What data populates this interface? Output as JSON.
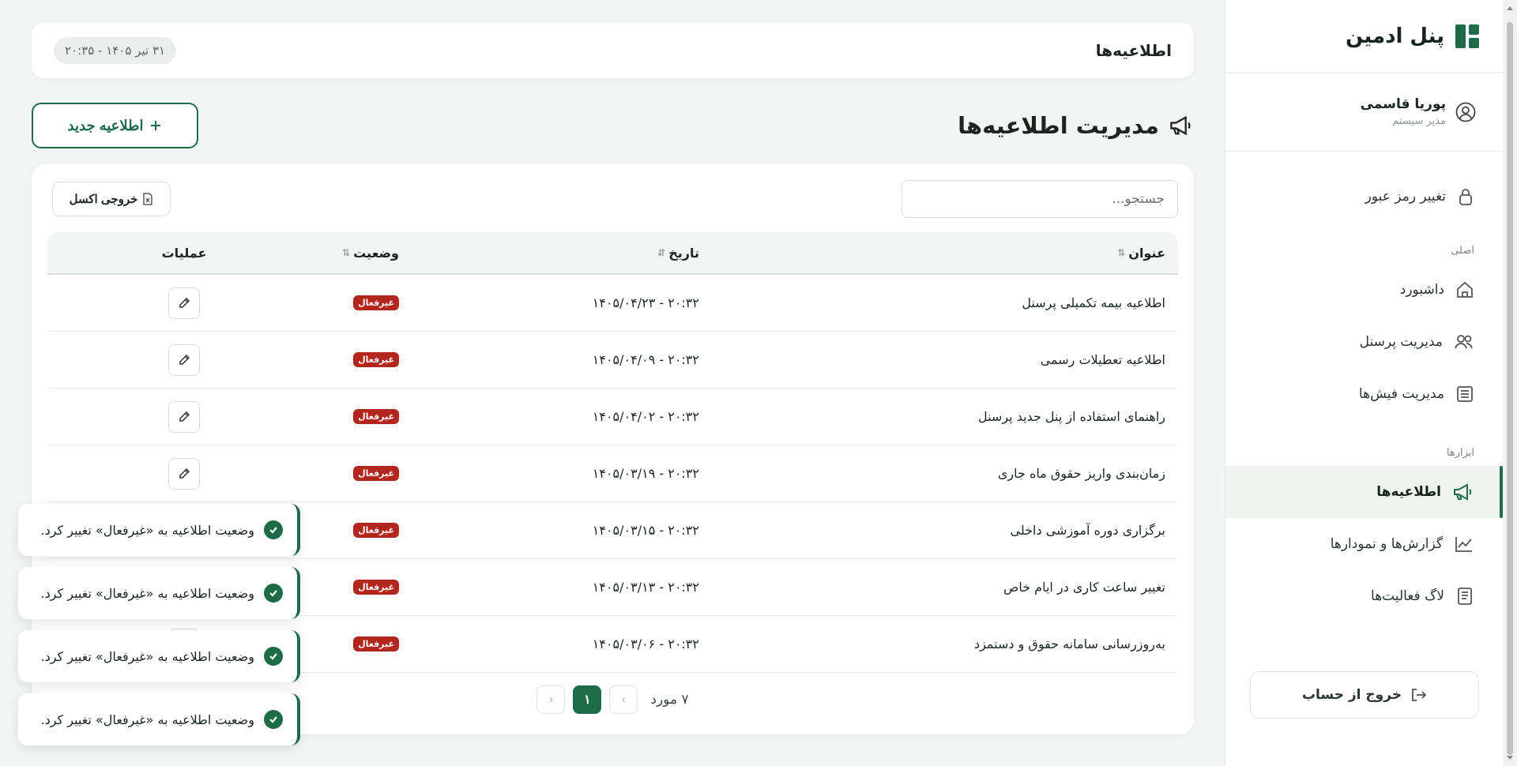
{
  "sidebar": {
    "brand": "پنل ادمین",
    "user": {
      "name": "پوریا قاسمی",
      "role": "مدیر سیستم"
    },
    "change_password": "تغییر رمز عبور",
    "section_main": "اصلی",
    "main_items": [
      {
        "label": "داشبورد",
        "icon": "home-icon"
      },
      {
        "label": "مدیریت پرسنل",
        "icon": "users-icon"
      },
      {
        "label": "مدیریت فیش‌ها",
        "icon": "receipt-icon"
      }
    ],
    "section_tools": "ابزارها",
    "tools_items": [
      {
        "label": "اطلاعیه‌ها",
        "icon": "megaphone-icon",
        "active": true
      },
      {
        "label": "گزارش‌ها و نمودارها",
        "icon": "chart-icon"
      },
      {
        "label": "لاگ فعالیت‌ها",
        "icon": "log-icon"
      }
    ],
    "logout": "خروج از حساب"
  },
  "topbar": {
    "title": "اطلاعیه‌ها",
    "datetime": "۳۱ تیر ۱۴۰۵ - ۲۰:۳۵"
  },
  "page": {
    "title": "مدیریت اطلاعیه‌ها",
    "new_button": "اطلاعیه جدید"
  },
  "toolbar": {
    "search_placeholder": "جستجو...",
    "excel_label": "خروجی اکسل"
  },
  "table": {
    "headers": {
      "title": "عنوان",
      "date": "تاریخ",
      "status": "وضعیت",
      "actions": "عملیات"
    },
    "rows": [
      {
        "title": "اطلاعیه بیمه تکمیلی پرسنل",
        "date": "۱۴۰۵/۰۴/۲۳ - ۲۰:۳۲",
        "status": "غیرفعال"
      },
      {
        "title": "اطلاعیه تعطیلات رسمی",
        "date": "۱۴۰۵/۰۴/۰۹ - ۲۰:۳۲",
        "status": "غیرفعال"
      },
      {
        "title": "راهنمای استفاده از پنل جدید پرسنل",
        "date": "۱۴۰۵/۰۴/۰۲ - ۲۰:۳۲",
        "status": "غیرفعال"
      },
      {
        "title": "زمان‌بندی واریز حقوق ماه جاری",
        "date": "۱۴۰۵/۰۳/۱۹ - ۲۰:۳۲",
        "status": "غیرفعال"
      },
      {
        "title": "برگزاری دوره آموزشی داخلی",
        "date": "۱۴۰۵/۰۳/۱۵ - ۲۰:۳۲",
        "status": "غیرفعال"
      },
      {
        "title": "تغییر ساعت کاری در ایام خاص",
        "date": "۱۴۰۵/۰۳/۱۳ - ۲۰:۳۲",
        "status": "غیرفعال"
      },
      {
        "title": "به‌روزرسانی سامانه حقوق و دستمزد",
        "date": "۱۴۰۵/۰۳/۰۶ - ۲۰:۳۲",
        "status": "غیرفعال"
      }
    ]
  },
  "pagination": {
    "count_label": "۷ مورد",
    "current_page": "۱"
  },
  "toasts": [
    "وضعیت اطلاعیه به «غیرفعال» تغییر کرد.",
    "وضعیت اطلاعیه به «غیرفعال» تغییر کرد.",
    "وضعیت اطلاعیه به «غیرفعال» تغییر کرد.",
    "وضعیت اطلاعیه به «غیرفعال» تغییر کرد."
  ],
  "colors": {
    "primary": "#1e6b4a",
    "danger": "#b3261e"
  }
}
